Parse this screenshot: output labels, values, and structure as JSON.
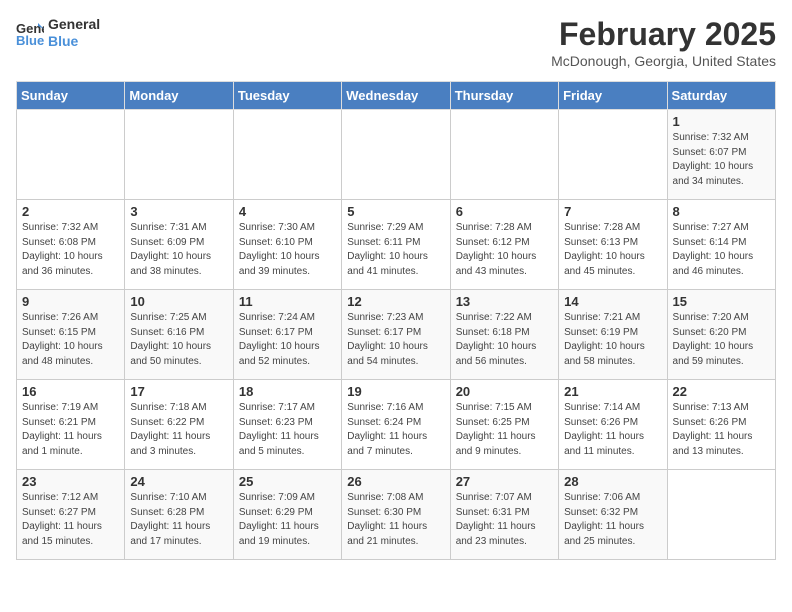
{
  "header": {
    "logo_line1": "General",
    "logo_line2": "Blue",
    "title": "February 2025",
    "subtitle": "McDonough, Georgia, United States"
  },
  "weekdays": [
    "Sunday",
    "Monday",
    "Tuesday",
    "Wednesday",
    "Thursday",
    "Friday",
    "Saturday"
  ],
  "weeks": [
    [
      {
        "day": "",
        "info": ""
      },
      {
        "day": "",
        "info": ""
      },
      {
        "day": "",
        "info": ""
      },
      {
        "day": "",
        "info": ""
      },
      {
        "day": "",
        "info": ""
      },
      {
        "day": "",
        "info": ""
      },
      {
        "day": "1",
        "info": "Sunrise: 7:32 AM\nSunset: 6:07 PM\nDaylight: 10 hours\nand 34 minutes."
      }
    ],
    [
      {
        "day": "2",
        "info": "Sunrise: 7:32 AM\nSunset: 6:08 PM\nDaylight: 10 hours\nand 36 minutes."
      },
      {
        "day": "3",
        "info": "Sunrise: 7:31 AM\nSunset: 6:09 PM\nDaylight: 10 hours\nand 38 minutes."
      },
      {
        "day": "4",
        "info": "Sunrise: 7:30 AM\nSunset: 6:10 PM\nDaylight: 10 hours\nand 39 minutes."
      },
      {
        "day": "5",
        "info": "Sunrise: 7:29 AM\nSunset: 6:11 PM\nDaylight: 10 hours\nand 41 minutes."
      },
      {
        "day": "6",
        "info": "Sunrise: 7:28 AM\nSunset: 6:12 PM\nDaylight: 10 hours\nand 43 minutes."
      },
      {
        "day": "7",
        "info": "Sunrise: 7:28 AM\nSunset: 6:13 PM\nDaylight: 10 hours\nand 45 minutes."
      },
      {
        "day": "8",
        "info": "Sunrise: 7:27 AM\nSunset: 6:14 PM\nDaylight: 10 hours\nand 46 minutes."
      }
    ],
    [
      {
        "day": "9",
        "info": "Sunrise: 7:26 AM\nSunset: 6:15 PM\nDaylight: 10 hours\nand 48 minutes."
      },
      {
        "day": "10",
        "info": "Sunrise: 7:25 AM\nSunset: 6:16 PM\nDaylight: 10 hours\nand 50 minutes."
      },
      {
        "day": "11",
        "info": "Sunrise: 7:24 AM\nSunset: 6:17 PM\nDaylight: 10 hours\nand 52 minutes."
      },
      {
        "day": "12",
        "info": "Sunrise: 7:23 AM\nSunset: 6:17 PM\nDaylight: 10 hours\nand 54 minutes."
      },
      {
        "day": "13",
        "info": "Sunrise: 7:22 AM\nSunset: 6:18 PM\nDaylight: 10 hours\nand 56 minutes."
      },
      {
        "day": "14",
        "info": "Sunrise: 7:21 AM\nSunset: 6:19 PM\nDaylight: 10 hours\nand 58 minutes."
      },
      {
        "day": "15",
        "info": "Sunrise: 7:20 AM\nSunset: 6:20 PM\nDaylight: 10 hours\nand 59 minutes."
      }
    ],
    [
      {
        "day": "16",
        "info": "Sunrise: 7:19 AM\nSunset: 6:21 PM\nDaylight: 11 hours\nand 1 minute."
      },
      {
        "day": "17",
        "info": "Sunrise: 7:18 AM\nSunset: 6:22 PM\nDaylight: 11 hours\nand 3 minutes."
      },
      {
        "day": "18",
        "info": "Sunrise: 7:17 AM\nSunset: 6:23 PM\nDaylight: 11 hours\nand 5 minutes."
      },
      {
        "day": "19",
        "info": "Sunrise: 7:16 AM\nSunset: 6:24 PM\nDaylight: 11 hours\nand 7 minutes."
      },
      {
        "day": "20",
        "info": "Sunrise: 7:15 AM\nSunset: 6:25 PM\nDaylight: 11 hours\nand 9 minutes."
      },
      {
        "day": "21",
        "info": "Sunrise: 7:14 AM\nSunset: 6:26 PM\nDaylight: 11 hours\nand 11 minutes."
      },
      {
        "day": "22",
        "info": "Sunrise: 7:13 AM\nSunset: 6:26 PM\nDaylight: 11 hours\nand 13 minutes."
      }
    ],
    [
      {
        "day": "23",
        "info": "Sunrise: 7:12 AM\nSunset: 6:27 PM\nDaylight: 11 hours\nand 15 minutes."
      },
      {
        "day": "24",
        "info": "Sunrise: 7:10 AM\nSunset: 6:28 PM\nDaylight: 11 hours\nand 17 minutes."
      },
      {
        "day": "25",
        "info": "Sunrise: 7:09 AM\nSunset: 6:29 PM\nDaylight: 11 hours\nand 19 minutes."
      },
      {
        "day": "26",
        "info": "Sunrise: 7:08 AM\nSunset: 6:30 PM\nDaylight: 11 hours\nand 21 minutes."
      },
      {
        "day": "27",
        "info": "Sunrise: 7:07 AM\nSunset: 6:31 PM\nDaylight: 11 hours\nand 23 minutes."
      },
      {
        "day": "28",
        "info": "Sunrise: 7:06 AM\nSunset: 6:32 PM\nDaylight: 11 hours\nand 25 minutes."
      },
      {
        "day": "",
        "info": ""
      }
    ]
  ]
}
